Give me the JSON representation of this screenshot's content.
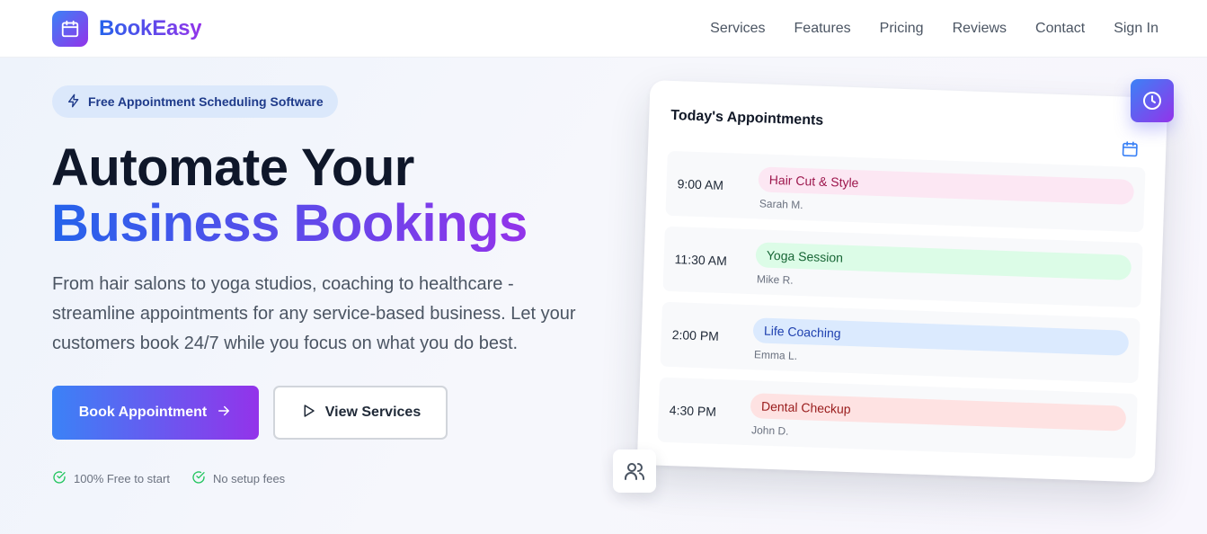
{
  "brand": {
    "name": "BookEasy",
    "logo_icon": "calendar-icon"
  },
  "nav": {
    "links": [
      "Services",
      "Features",
      "Pricing",
      "Reviews",
      "Contact",
      "Sign In"
    ]
  },
  "hero": {
    "badge": {
      "icon": "lightning-icon",
      "text": "Free Appointment Scheduling Software"
    },
    "headline_line1": "Automate Your",
    "headline_line2": "Business Bookings",
    "lead": "From hair salons to yoga studios, coaching to healthcare - streamline appointments for any service-based business. Let your customers book 24/7 while you focus on what you do best.",
    "primary_cta": {
      "label": "Book Appointment",
      "icon": "arrow-right-icon"
    },
    "secondary_cta": {
      "label": "View Services",
      "icon": "play-icon"
    },
    "perks": [
      "100% Free to start",
      "No setup fees"
    ]
  },
  "card": {
    "title": "Today's Appointments",
    "appointments": [
      {
        "time": "9:00 AM",
        "service": "Hair Cut & Style",
        "client": "Sarah M.",
        "bg": "#fce7f3",
        "fg": "#9d174d"
      },
      {
        "time": "11:30 AM",
        "service": "Yoga Session",
        "client": "Mike R.",
        "bg": "#dcfce7",
        "fg": "#166534"
      },
      {
        "time": "2:00 PM",
        "service": "Life Coaching",
        "client": "Emma L.",
        "bg": "#dbeafe",
        "fg": "#1e40af"
      },
      {
        "time": "4:30 PM",
        "service": "Dental Checkup",
        "client": "John D.",
        "bg": "#fee2e2",
        "fg": "#991b1b"
      }
    ]
  },
  "colors": {
    "gradient_start": "#3b82f6",
    "gradient_end": "#9333ea",
    "perk_check": "#22c55e"
  }
}
